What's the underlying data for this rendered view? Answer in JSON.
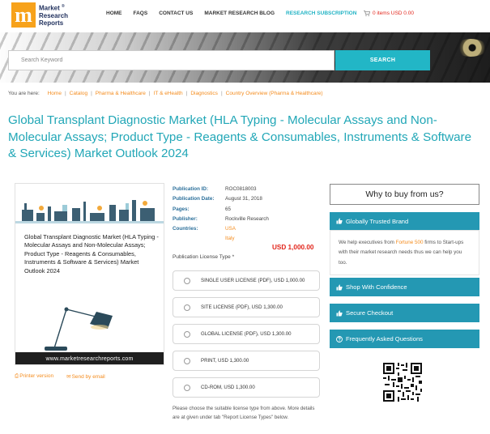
{
  "brand": {
    "line1": "Market",
    "line2": "Research",
    "line3": "Reports",
    "mark": "m",
    "reg": "®"
  },
  "nav": [
    {
      "label": "HOME"
    },
    {
      "label": "FAQS"
    },
    {
      "label": "CONTACT US"
    },
    {
      "label": "MARKET RESEARCH BLOG"
    },
    {
      "label": "RESEARCH SUBSCRIPTION"
    }
  ],
  "cart": {
    "label": "0 items USD 0.00",
    "icon": "cart-icon"
  },
  "search": {
    "placeholder": "Search Keyword",
    "button": "SEARCH"
  },
  "breadcrumb": {
    "prefix": "You are here:",
    "items": [
      "Home",
      "Catalog",
      "Pharma & Healthcare",
      "IT & eHealth",
      "Diagnostics",
      "Country Overview (Pharma & Healthcare)"
    ]
  },
  "title": "Global Transplant Diagnostic Market (HLA Typing - Molecular Assays and Non-Molecular Assays; Product Type - Reagents & Consumables, Instruments & Software & Services) Market Outlook 2024",
  "cover": {
    "text": "Global Transplant Diagnostic Market (HLA Typing - Molecular Assays and Non-Molecular Assays; Product Type - Reagents & Consumables, Instruments & Software & Services) Market Outlook 2024",
    "url": "www.marketresearchreports.com"
  },
  "actions": {
    "print": "Printer version",
    "email": "Send by email"
  },
  "meta": {
    "id_label": "Publication ID:",
    "id": "ROC0818003",
    "date_label": "Publication Date:",
    "date": "August 31, 2018",
    "pages_label": "Pages:",
    "pages": "65",
    "publisher_label": "Publisher:",
    "publisher": "Rockville Research",
    "countries_label": "Countries:",
    "country1": "USA",
    "country2": "Italy"
  },
  "price": "USD 1,000.00",
  "license": {
    "label": "Publication License Type *",
    "options": [
      "SINGLE USER LICENSE (PDF), USD 1,000.00",
      "SITE LICENSE (PDF), USD 1,300.00",
      "GLOBAL LICENSE (PDF), USD 1,300.00",
      "PRINT, USD 1,300.00",
      "CD-ROM, USD 1,300.00"
    ],
    "note": "Please choose the suitable license type from above. More details are at given under tab \"Report License Types\" below."
  },
  "sidebar": {
    "why": "Why to buy from us?",
    "trusted": "Globally Trusted Brand",
    "desc_pre": "We help executives from ",
    "desc_hl": "Fortune 500",
    "desc_post": " firms to Start-ups with their market research needs thus we can help you too.",
    "shop": "Shop With Confidence",
    "checkout": "Secure Checkout",
    "faq": "Frequently Asked Questions"
  },
  "colors": {
    "accent": "#22b6c6",
    "title": "#22a7b7",
    "link": "#f48c1e",
    "price": "#e2261c",
    "sidebar": "#2498b3",
    "logo": "#f7a21b"
  }
}
